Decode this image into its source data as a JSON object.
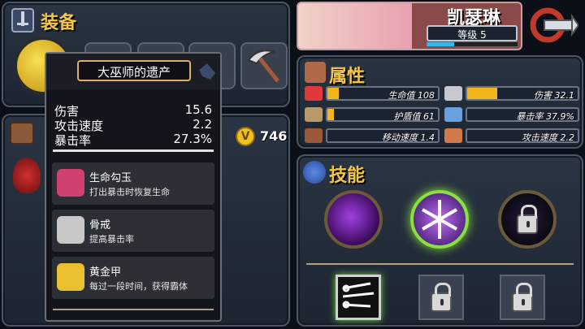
{
  "equipment": {
    "title": "装备",
    "gold_count": "746"
  },
  "character": {
    "name": "凯瑟琳",
    "level_label": "等级 5"
  },
  "attributes": {
    "title": "属性",
    "left": [
      {
        "label": "生命值 108",
        "fill": 0.1,
        "icon": "heart-icon",
        "color": "#e03a3a"
      },
      {
        "label": "护盾值 61",
        "fill": 0.06,
        "icon": "shield-icon",
        "color": "#b89a6a"
      },
      {
        "label": "移动速度 1.4",
        "fill": 0.0,
        "icon": "boot-icon",
        "color": "#9a5a3a"
      }
    ],
    "right": [
      {
        "label": "伤害 32.1",
        "fill": 0.27,
        "icon": "sword-icon",
        "color": "#c8c8d0"
      },
      {
        "label": "暴击率 37.9%",
        "fill": 0.0,
        "icon": "eye-icon",
        "color": "#6aa0e0"
      },
      {
        "label": "攻击速度 2.2",
        "fill": 0.0,
        "icon": "fist-icon",
        "color": "#d07a4a"
      }
    ]
  },
  "skills": {
    "title": "技能"
  },
  "tooltip": {
    "item_name": "大巫师的遗产",
    "stats": [
      {
        "label": "伤害",
        "value": "15.6"
      },
      {
        "label": "攻击速度",
        "value": "2.2"
      },
      {
        "label": "暴击率",
        "value": "27.3%"
      }
    ],
    "perks": [
      {
        "name": "生命勾玉",
        "desc": "打出暴击时恢复生命",
        "icon": "magatama-icon"
      },
      {
        "name": "骨戒",
        "desc": "提高暴击率",
        "icon": "bone-ring-icon"
      },
      {
        "name": "黄金甲",
        "desc": "每过一段时间，获得霸体",
        "icon": "gold-armor-icon"
      }
    ]
  }
}
